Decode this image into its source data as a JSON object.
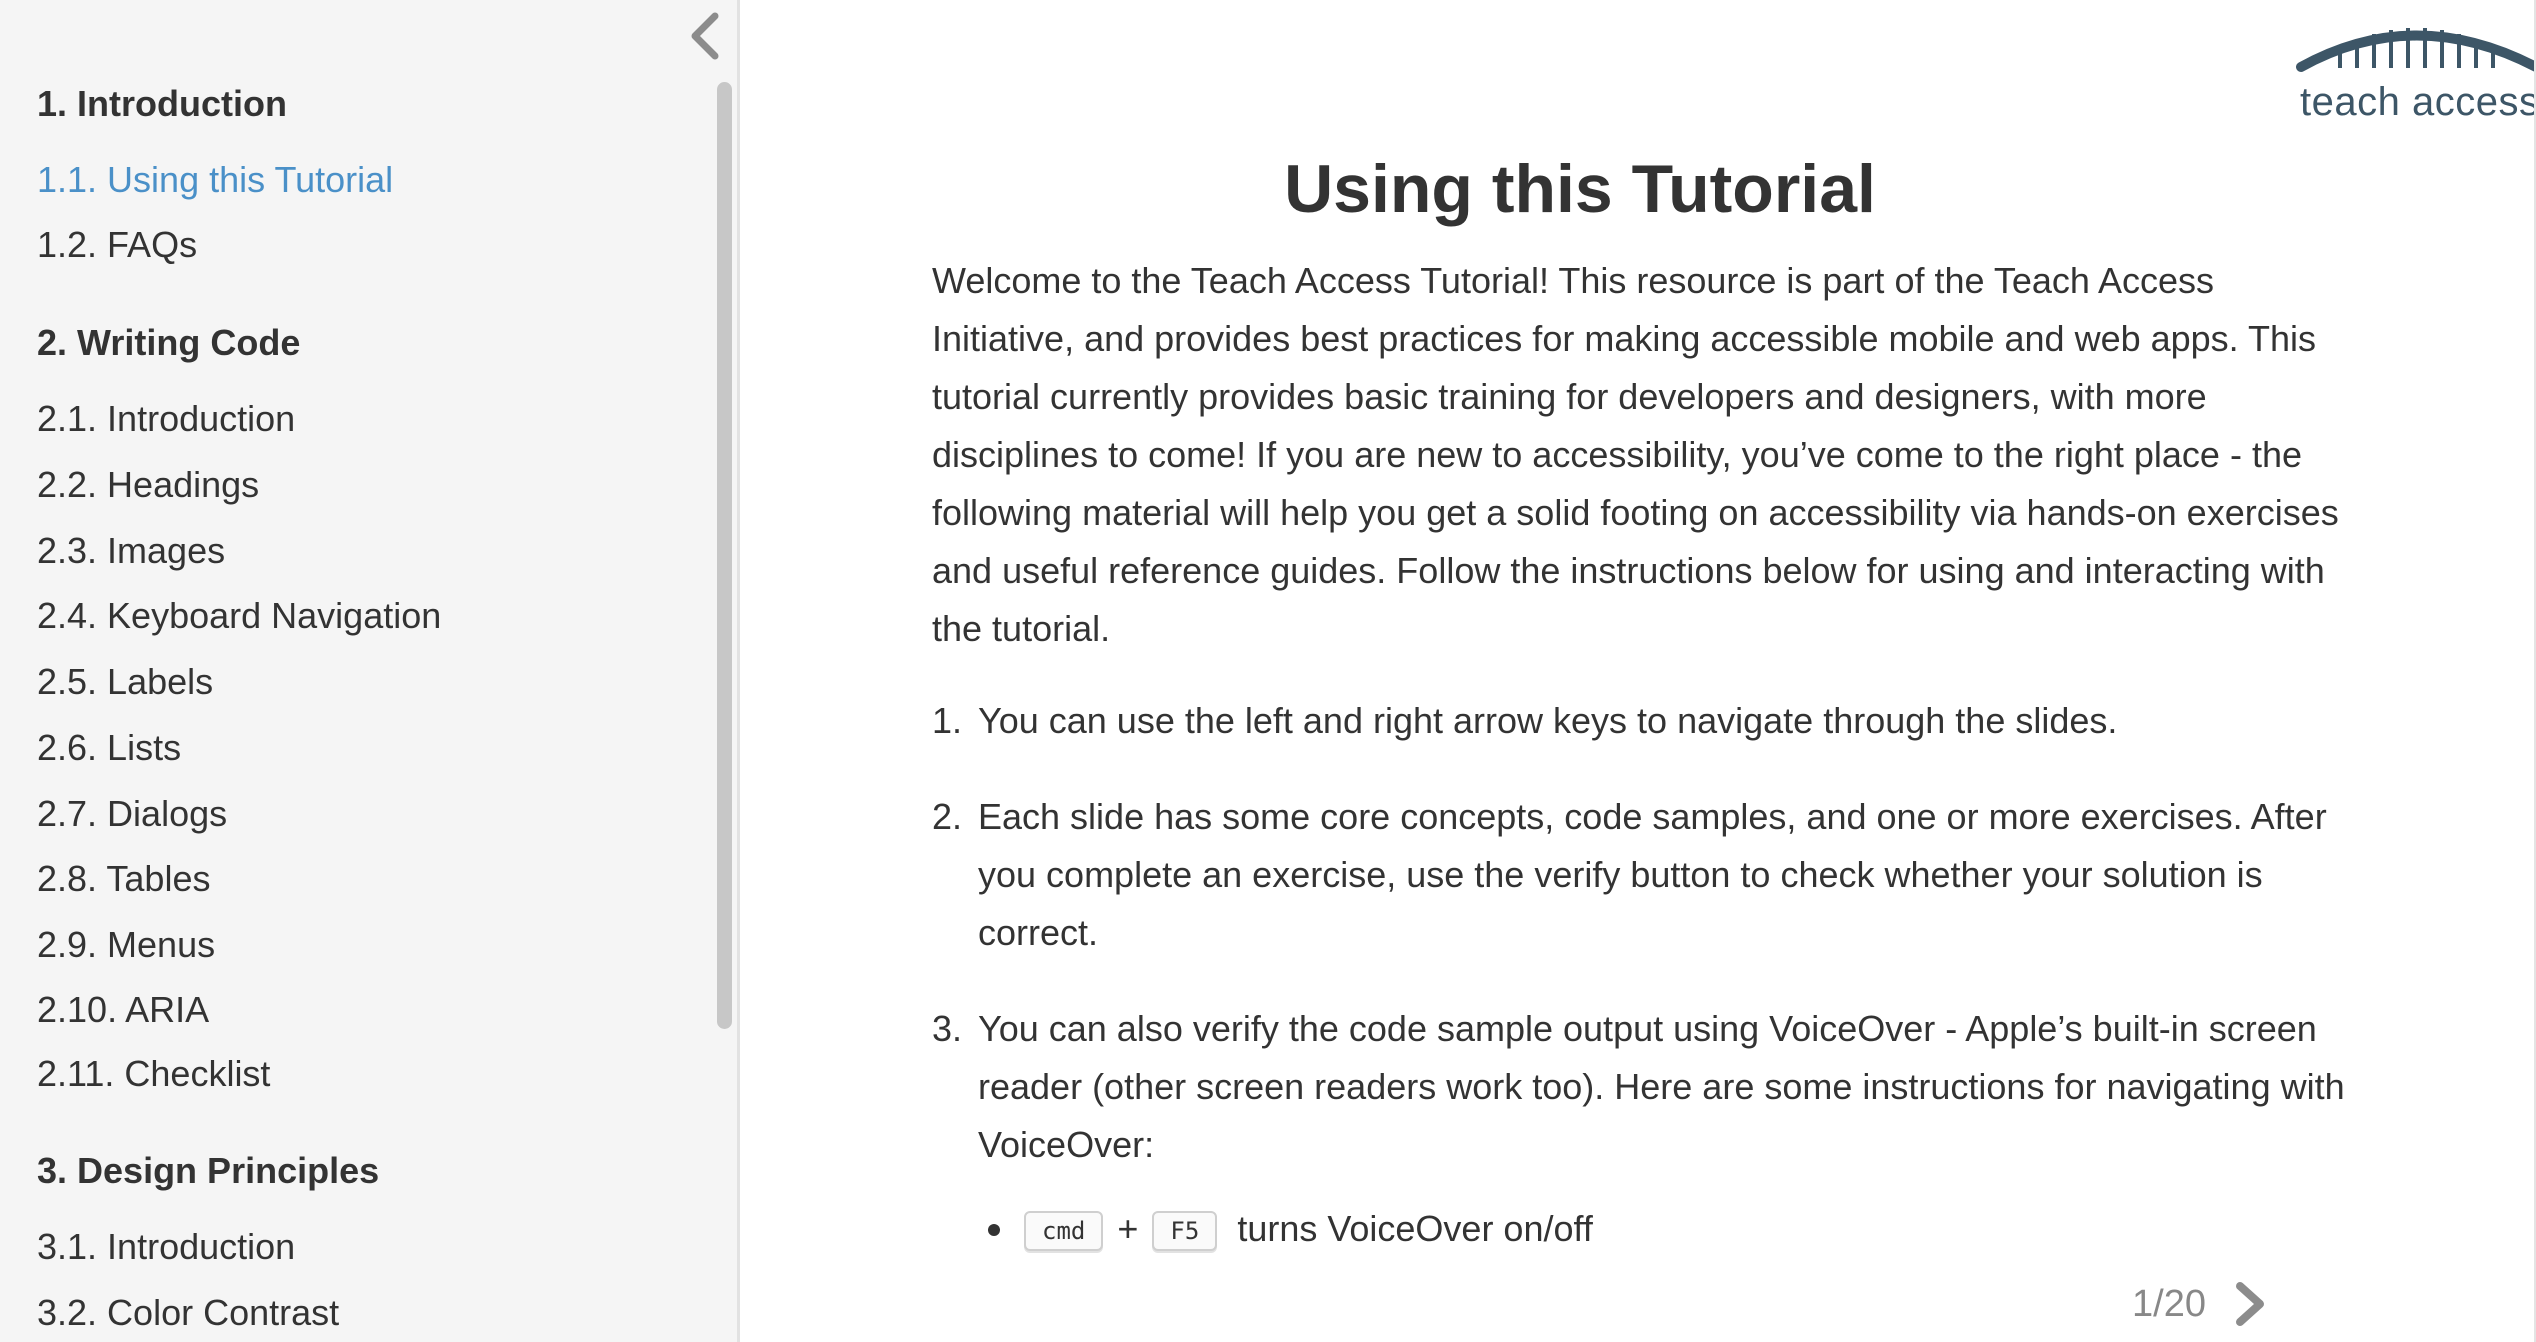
{
  "sidebar": {
    "sections": [
      {
        "title": "1. Introduction",
        "items": [
          {
            "label": "1.1. Using this Tutorial",
            "active": true
          },
          {
            "label": "1.2. FAQs",
            "active": false
          }
        ]
      },
      {
        "title": "2. Writing Code",
        "items": [
          {
            "label": "2.1. Introduction"
          },
          {
            "label": "2.2. Headings"
          },
          {
            "label": "2.3. Images"
          },
          {
            "label": "2.4. Keyboard Navigation"
          },
          {
            "label": "2.5. Labels"
          },
          {
            "label": "2.6. Lists"
          },
          {
            "label": "2.7. Dialogs"
          },
          {
            "label": "2.8. Tables"
          },
          {
            "label": "2.9. Menus"
          },
          {
            "label": "2.10. ARIA"
          },
          {
            "label": "2.11. Checklist"
          }
        ]
      },
      {
        "title": "3. Design Principles",
        "items": [
          {
            "label": "3.1. Introduction"
          },
          {
            "label": "3.2. Color Contrast"
          }
        ]
      }
    ],
    "collapse_icon": "chevron-left-icon"
  },
  "logo": {
    "text": "teach access",
    "color": "#3d5667"
  },
  "main": {
    "title": "Using this Tutorial",
    "intro": "Welcome to the Teach Access Tutorial! This resource is part of the Teach Access Initiative, and provides best practices for making accessible mobile and web apps. This tutorial currently provides basic training for developers and designers, with more disciplines to come! If you are new to accessibility, you’ve come to the right place - the following material will help you get a solid footing on accessibility via hands-on exercises and useful reference guides. Follow the instructions below for using and interacting with the tutorial.",
    "steps": [
      {
        "num": "1.",
        "text": "You can use the left and right arrow keys to navigate through the slides."
      },
      {
        "num": "2.",
        "text": "Each slide has some core concepts, code samples, and one or more exercises. After you complete an exercise, use the verify button to check whether your solution is correct."
      },
      {
        "num": "3.",
        "text": "You can also verify the code sample output using VoiceOver - Apple’s built-in screen reader (other screen readers work too). Here are some instructions for navigating with VoiceOver:"
      }
    ],
    "bullets": [
      {
        "key1": "cmd",
        "plus": "+",
        "key2": "F5",
        "text": "turns VoiceOver on/off"
      }
    ]
  },
  "pager": {
    "count": "1/20",
    "next_icon": "chevron-right-icon"
  },
  "colors": {
    "accent": "#4a90c8",
    "sidebar_bg": "#f5f5f5",
    "text": "#333333",
    "muted": "#888888"
  }
}
